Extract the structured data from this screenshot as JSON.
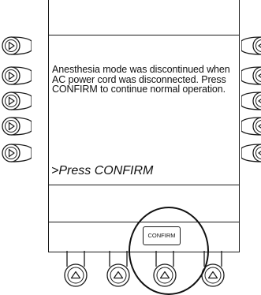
{
  "screen": {
    "message": "Anesthesia mode was discontinued when AC power cord was disconnected. Press CONFIRM to continue normal operation.",
    "prompt": ">Press CONFIRM",
    "softkey_confirm_label": "CONFIRM"
  },
  "icons": {
    "left_keys": "play-right-icon",
    "right_keys": "play-left-icon",
    "bottom_keys": "play-up-icon"
  },
  "colors": {
    "outline": "#1a1a1a",
    "background": "#ffffff"
  }
}
